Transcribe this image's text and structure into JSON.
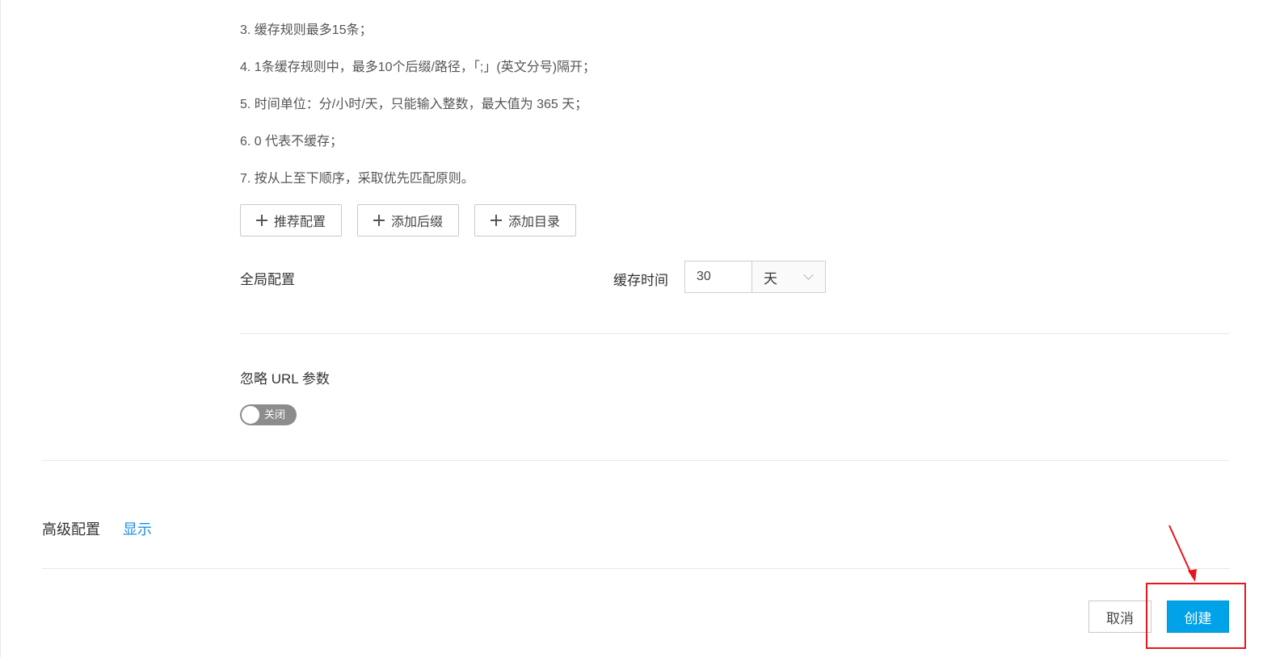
{
  "cache_rules": {
    "partial_top_text": "...)",
    "rules": [
      "3. 缓存规则最多15条；",
      "4. 1条缓存规则中，最多10个后缀/路径，「;」(英文分号)隔开；",
      "5. 时间单位：分/小时/天，只能输入整数，最大值为 365 天；",
      "6. 0 代表不缓存；",
      "7. 按从上至下顺序，采取优先匹配原则。"
    ],
    "buttons": {
      "recommend": "推荐配置",
      "add_suffix": "添加后缀",
      "add_directory": "添加目录"
    }
  },
  "global_config": {
    "label": "全局配置",
    "cache_time_label": "缓存时间",
    "cache_time_value": "30",
    "unit_selected": "天"
  },
  "ignore_url_params": {
    "label": "忽略 URL 参数",
    "switch_text": "关闭",
    "enabled": false
  },
  "advanced": {
    "label": "高级配置",
    "toggle_text": "显示"
  },
  "footer": {
    "cancel_label": "取消",
    "create_label": "创建"
  },
  "annotation": {
    "color": "#e8151b"
  }
}
